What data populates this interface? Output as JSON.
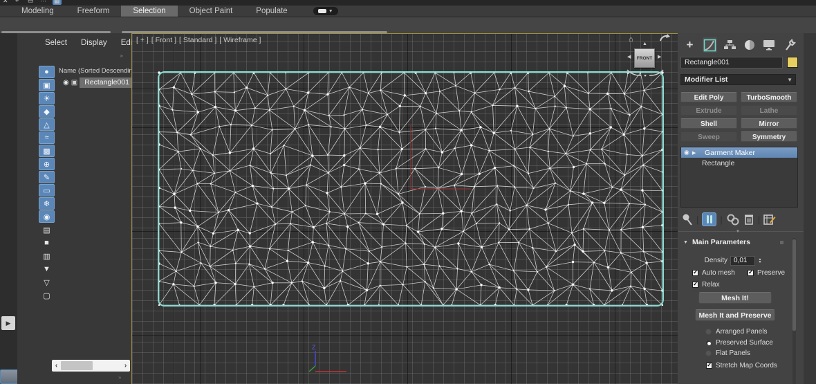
{
  "ribbon": {
    "tabs": [
      {
        "label": "Modeling",
        "active": false
      },
      {
        "label": "Freeform",
        "active": false
      },
      {
        "label": "Selection",
        "active": true
      },
      {
        "label": "Object Paint",
        "active": false
      },
      {
        "label": "Populate",
        "active": false
      }
    ]
  },
  "scene_explorer": {
    "menu": {
      "select": "Select",
      "display": "Display",
      "edit": "Edit"
    },
    "more_indicator": "»",
    "name_header": "Name (Sorted Descending)",
    "object_row": {
      "label": "Rectangle001"
    },
    "filter_icons": [
      {
        "name": "display-geometry-icon",
        "glyph": "●",
        "active": true
      },
      {
        "name": "display-shapes-icon",
        "glyph": "▣",
        "active": true
      },
      {
        "name": "display-lights-icon",
        "glyph": "☀",
        "active": true
      },
      {
        "name": "display-cameras-icon",
        "glyph": "◆",
        "active": true
      },
      {
        "name": "display-helpers-icon",
        "glyph": "△",
        "active": true
      },
      {
        "name": "display-spacewarps-icon",
        "glyph": "≈",
        "active": true
      },
      {
        "name": "display-groups-icon",
        "glyph": "▩",
        "active": true
      },
      {
        "name": "display-xrefs-icon",
        "glyph": "⊕",
        "active": true
      },
      {
        "name": "display-bones-icon",
        "glyph": "✎",
        "active": true
      },
      {
        "name": "display-containers-icon",
        "glyph": "▭",
        "active": true
      },
      {
        "name": "display-frozen-icon",
        "glyph": "❄",
        "active": true
      },
      {
        "name": "display-hidden-icon",
        "glyph": "◉",
        "active": true
      },
      {
        "name": "list-view-icon",
        "glyph": "▤",
        "active": false
      },
      {
        "name": "blank-swatch-icon",
        "glyph": "■",
        "active": false
      },
      {
        "name": "properties-view-icon",
        "glyph": "▥",
        "active": false
      },
      {
        "name": "filter-disabled-icon",
        "glyph": "▼",
        "active": false
      },
      {
        "name": "filter-icon",
        "glyph": "▽",
        "active": false
      },
      {
        "name": "new-container-icon",
        "glyph": "▢",
        "active": false
      }
    ]
  },
  "viewport": {
    "label_parts": [
      "[ + ]",
      "[ Front ]",
      "[ Standard ]",
      "[ Wireframe ]"
    ],
    "viewcube_face": "FRONT",
    "axis_z_label": "Z"
  },
  "command_panel": {
    "object_name": "Rectangle001",
    "modifier_list_label": "Modifier List",
    "modifier_buttons": [
      {
        "label": "Edit Poly",
        "enabled": true
      },
      {
        "label": "TurboSmooth",
        "enabled": true
      },
      {
        "label": "Extrude",
        "enabled": false
      },
      {
        "label": "Lathe",
        "enabled": false
      },
      {
        "label": "Shell",
        "enabled": true
      },
      {
        "label": "Mirror",
        "enabled": true
      },
      {
        "label": "Sweep",
        "enabled": false
      },
      {
        "label": "Symmetry",
        "enabled": true
      }
    ],
    "stack": [
      {
        "label": "Garment Maker",
        "selected": true
      },
      {
        "label": "Rectangle",
        "selected": false
      }
    ],
    "rollout": {
      "title": "Main Parameters",
      "density_label": "Density",
      "density_value": "0,01",
      "auto_mesh": {
        "label": "Auto mesh",
        "checked": true
      },
      "preserve": {
        "label": "Preserve",
        "checked": true
      },
      "relax": {
        "label": "Relax",
        "checked": true
      },
      "mesh_it_label": "Mesh It!",
      "mesh_it_preserve_label": "Mesh It and Preserve",
      "radios": [
        {
          "label": "Arranged Panels",
          "selected": false
        },
        {
          "label": "Preserved Surface",
          "selected": true
        },
        {
          "label": "Flat Panels",
          "selected": false
        }
      ],
      "stretch": {
        "label": "Stretch Map Coords",
        "checked": true
      }
    }
  },
  "colors": {
    "accent_teal": "#85dcd2",
    "selection_blue": "#5b87b8",
    "swatch_yellow": "#e6cf5e",
    "mesh_edge": "#d9d9d9",
    "seam_red": "#8b3535",
    "viewport_border_yellow": "#9c8f3f"
  }
}
